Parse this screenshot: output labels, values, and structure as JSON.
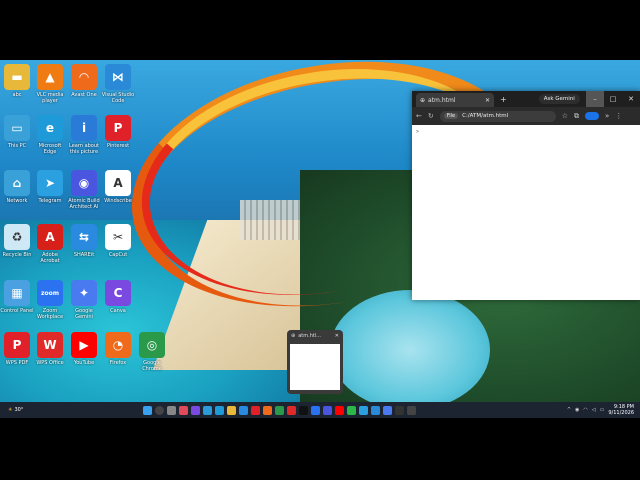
{
  "desktop_icons": [
    {
      "label": "abc",
      "icon": "folder-icon",
      "color": "#e8b83a",
      "glyph": "▬"
    },
    {
      "label": "VLC media player",
      "icon": "vlc-icon",
      "color": "#f07b12",
      "glyph": "▲"
    },
    {
      "label": "Avast One",
      "icon": "avast-icon",
      "color": "#f06a1c",
      "glyph": "◠"
    },
    {
      "label": "Visual Studio Code",
      "icon": "vscode-icon",
      "color": "#2a8ad8",
      "glyph": "⋈"
    },
    {
      "label": "This PC",
      "icon": "monitor-icon",
      "color": "#3aa0d8",
      "glyph": "▭"
    },
    {
      "label": "Microsoft Edge",
      "icon": "edge-icon",
      "color": "#1e9ad8",
      "glyph": "e"
    },
    {
      "label": "Learn about this picture",
      "icon": "info-camera-icon",
      "color": "#2a7ad8",
      "glyph": "i"
    },
    {
      "label": "Pinterest",
      "icon": "pinterest-icon",
      "color": "#e0212a",
      "glyph": "P"
    },
    {
      "label": "Network",
      "icon": "network-icon",
      "color": "#3aa0d8",
      "glyph": "⌂"
    },
    {
      "label": "Telegram",
      "icon": "telegram-icon",
      "color": "#2aa0e0",
      "glyph": "➤"
    },
    {
      "label": "Atomic Build Architect AI",
      "icon": "atomic-icon",
      "color": "#4a56e0",
      "glyph": "◉"
    },
    {
      "label": "Windscribe",
      "icon": "windscribe-icon",
      "color": "#ffffff",
      "glyph": "A"
    },
    {
      "label": "Recycle Bin",
      "icon": "recycle-bin-icon",
      "color": "#cfe8f5",
      "glyph": "♻"
    },
    {
      "label": "Adobe Acrobat",
      "icon": "acrobat-icon",
      "color": "#d8201a",
      "glyph": "A"
    },
    {
      "label": "SHAREit",
      "icon": "shareit-icon",
      "color": "#2a8ae0",
      "glyph": "⇆"
    },
    {
      "label": "CapCut",
      "icon": "capcut-icon",
      "color": "#ffffff",
      "glyph": "✂"
    },
    {
      "label": "Control Panel",
      "icon": "control-panel-icon",
      "color": "#4aa0e0",
      "glyph": "▦"
    },
    {
      "label": "Zoom Workplace",
      "icon": "zoom-icon",
      "color": "#2a72f0",
      "glyph": "zoom"
    },
    {
      "label": "Google Gemini",
      "icon": "gemini-icon",
      "color": "#4a7af0",
      "glyph": "✦"
    },
    {
      "label": "Canva",
      "icon": "canva-icon",
      "color": "#7a4ae0",
      "glyph": "C"
    },
    {
      "label": "WPS PDF",
      "icon": "wps-pdf-icon",
      "color": "#e0212a",
      "glyph": "P"
    },
    {
      "label": "WPS Office",
      "icon": "wps-office-icon",
      "color": "#e02a2a",
      "glyph": "W"
    },
    {
      "label": "YouTube",
      "icon": "youtube-icon",
      "color": "#ff0000",
      "glyph": "▶"
    },
    {
      "label": "Firefox",
      "icon": "firefox-icon",
      "color": "#f06a1c",
      "glyph": "◔"
    },
    {
      "label": "Google Chrome",
      "icon": "chrome-icon",
      "color": "#2a9a4a",
      "glyph": "◎"
    }
  ],
  "browser": {
    "tab_title": "atm.html",
    "tab_close": "✕",
    "new_tab": "+",
    "ask_gemini": "Ask Gemini",
    "min": "–",
    "max": "□",
    "close": "✕",
    "url_scheme": "File",
    "url": "C:/ATM/atm.html",
    "content_text": ">"
  },
  "thumbnail": {
    "title": "atm.htl...",
    "close": "✕"
  },
  "taskbar": {
    "weather": "30°",
    "time": "9:18 PM",
    "date": "9/11/2026"
  }
}
